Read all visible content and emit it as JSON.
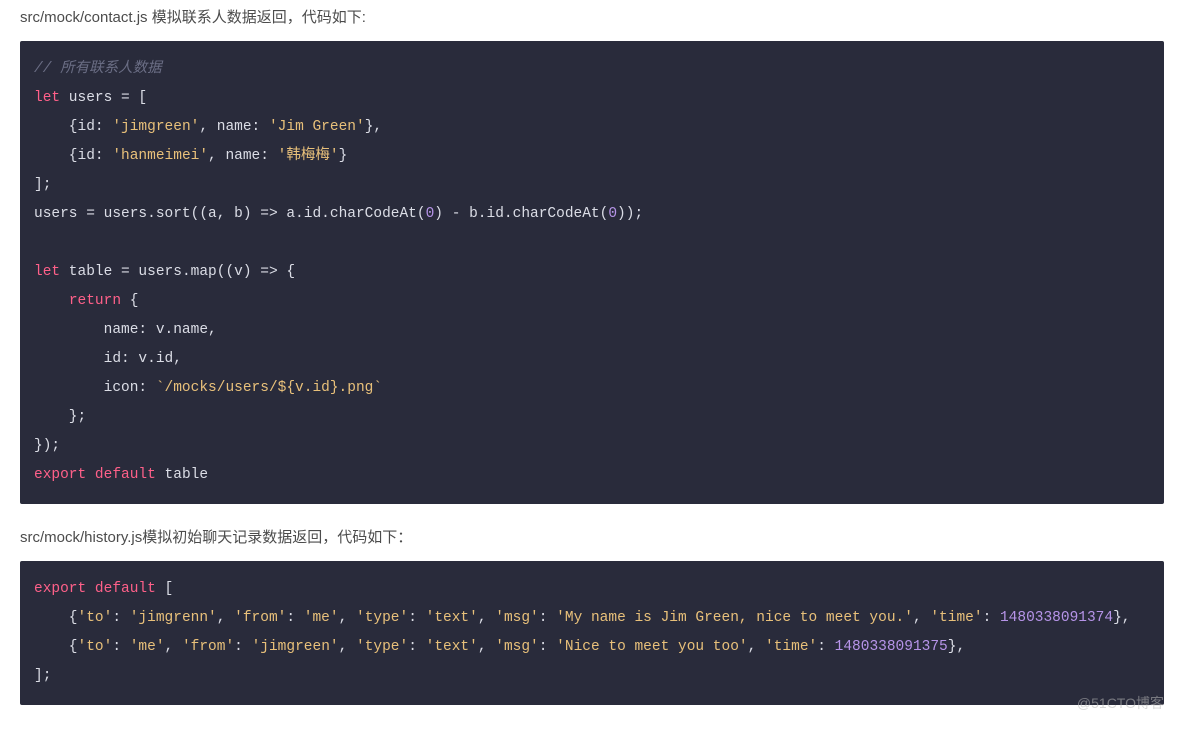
{
  "intro1": "src/mock/contact.js 模拟联系人数据返回，代码如下:",
  "intro2": "src/mock/history.js模拟初始聊天记录数据返回，代码如下：",
  "watermark": "@51CTO博客",
  "code1": {
    "tokens": [
      [
        "comment",
        "// 所有联系人数据"
      ],
      [
        "nl",
        ""
      ],
      [
        "keyword",
        "let"
      ],
      [
        "ident",
        " users "
      ],
      [
        "oper",
        "="
      ],
      [
        "ident",
        " ["
      ],
      [
        "nl",
        ""
      ],
      [
        "ident",
        "    {id: "
      ],
      [
        "string",
        "'jimgreen'"
      ],
      [
        "ident",
        ", name: "
      ],
      [
        "string",
        "'Jim Green'"
      ],
      [
        "ident",
        "},"
      ],
      [
        "nl",
        ""
      ],
      [
        "ident",
        "    {id: "
      ],
      [
        "string",
        "'hanmeimei'"
      ],
      [
        "ident",
        ", name: "
      ],
      [
        "string",
        "'韩梅梅'"
      ],
      [
        "ident",
        "}"
      ],
      [
        "nl",
        ""
      ],
      [
        "ident",
        "];"
      ],
      [
        "nl",
        ""
      ],
      [
        "ident",
        "users "
      ],
      [
        "oper",
        "="
      ],
      [
        "ident",
        " users.sort((a, b) "
      ],
      [
        "oper",
        "=>"
      ],
      [
        "ident",
        " a.id.charCodeAt("
      ],
      [
        "number",
        "0"
      ],
      [
        "ident",
        ") "
      ],
      [
        "oper",
        "-"
      ],
      [
        "ident",
        " b.id.charCodeAt("
      ],
      [
        "number",
        "0"
      ],
      [
        "ident",
        "));"
      ],
      [
        "nl",
        ""
      ],
      [
        "nl",
        ""
      ],
      [
        "keyword",
        "let"
      ],
      [
        "ident",
        " table "
      ],
      [
        "oper",
        "="
      ],
      [
        "ident",
        " users.map((v) "
      ],
      [
        "oper",
        "=>"
      ],
      [
        "ident",
        " {"
      ],
      [
        "nl",
        ""
      ],
      [
        "ident",
        "    "
      ],
      [
        "keyword",
        "return"
      ],
      [
        "ident",
        " {"
      ],
      [
        "nl",
        ""
      ],
      [
        "ident",
        "        name: v.name,"
      ],
      [
        "nl",
        ""
      ],
      [
        "ident",
        "        id: v.id,"
      ],
      [
        "nl",
        ""
      ],
      [
        "ident",
        "        icon: "
      ],
      [
        "string",
        "`/mocks/users/${v.id}.png`"
      ],
      [
        "nl",
        ""
      ],
      [
        "ident",
        "    };"
      ],
      [
        "nl",
        ""
      ],
      [
        "ident",
        "});"
      ],
      [
        "nl",
        ""
      ],
      [
        "keyword",
        "export"
      ],
      [
        "ident",
        " "
      ],
      [
        "keyword",
        "default"
      ],
      [
        "ident",
        " table"
      ]
    ]
  },
  "code2": {
    "tokens": [
      [
        "keyword",
        "export"
      ],
      [
        "ident",
        " "
      ],
      [
        "keyword",
        "default"
      ],
      [
        "ident",
        " ["
      ],
      [
        "nl",
        ""
      ],
      [
        "ident",
        "    {"
      ],
      [
        "string",
        "'to'"
      ],
      [
        "ident",
        ": "
      ],
      [
        "string",
        "'jimgrenn'"
      ],
      [
        "ident",
        ", "
      ],
      [
        "string",
        "'from'"
      ],
      [
        "ident",
        ": "
      ],
      [
        "string",
        "'me'"
      ],
      [
        "ident",
        ", "
      ],
      [
        "string",
        "'type'"
      ],
      [
        "ident",
        ": "
      ],
      [
        "string",
        "'text'"
      ],
      [
        "ident",
        ", "
      ],
      [
        "string",
        "'msg'"
      ],
      [
        "ident",
        ": "
      ],
      [
        "string",
        "'My name is Jim Green, nice to meet you.'"
      ],
      [
        "ident",
        ", "
      ],
      [
        "string",
        "'time'"
      ],
      [
        "ident",
        ": "
      ],
      [
        "number",
        "1480338091374"
      ],
      [
        "ident",
        "},"
      ],
      [
        "nl",
        ""
      ],
      [
        "ident",
        "    {"
      ],
      [
        "string",
        "'to'"
      ],
      [
        "ident",
        ": "
      ],
      [
        "string",
        "'me'"
      ],
      [
        "ident",
        ", "
      ],
      [
        "string",
        "'from'"
      ],
      [
        "ident",
        ": "
      ],
      [
        "string",
        "'jimgreen'"
      ],
      [
        "ident",
        ", "
      ],
      [
        "string",
        "'type'"
      ],
      [
        "ident",
        ": "
      ],
      [
        "string",
        "'text'"
      ],
      [
        "ident",
        ", "
      ],
      [
        "string",
        "'msg'"
      ],
      [
        "ident",
        ": "
      ],
      [
        "string",
        "'Nice to meet you too'"
      ],
      [
        "ident",
        ", "
      ],
      [
        "string",
        "'time'"
      ],
      [
        "ident",
        ": "
      ],
      [
        "number",
        "1480338091375"
      ],
      [
        "ident",
        "},"
      ],
      [
        "nl",
        ""
      ],
      [
        "ident",
        "];"
      ]
    ]
  }
}
